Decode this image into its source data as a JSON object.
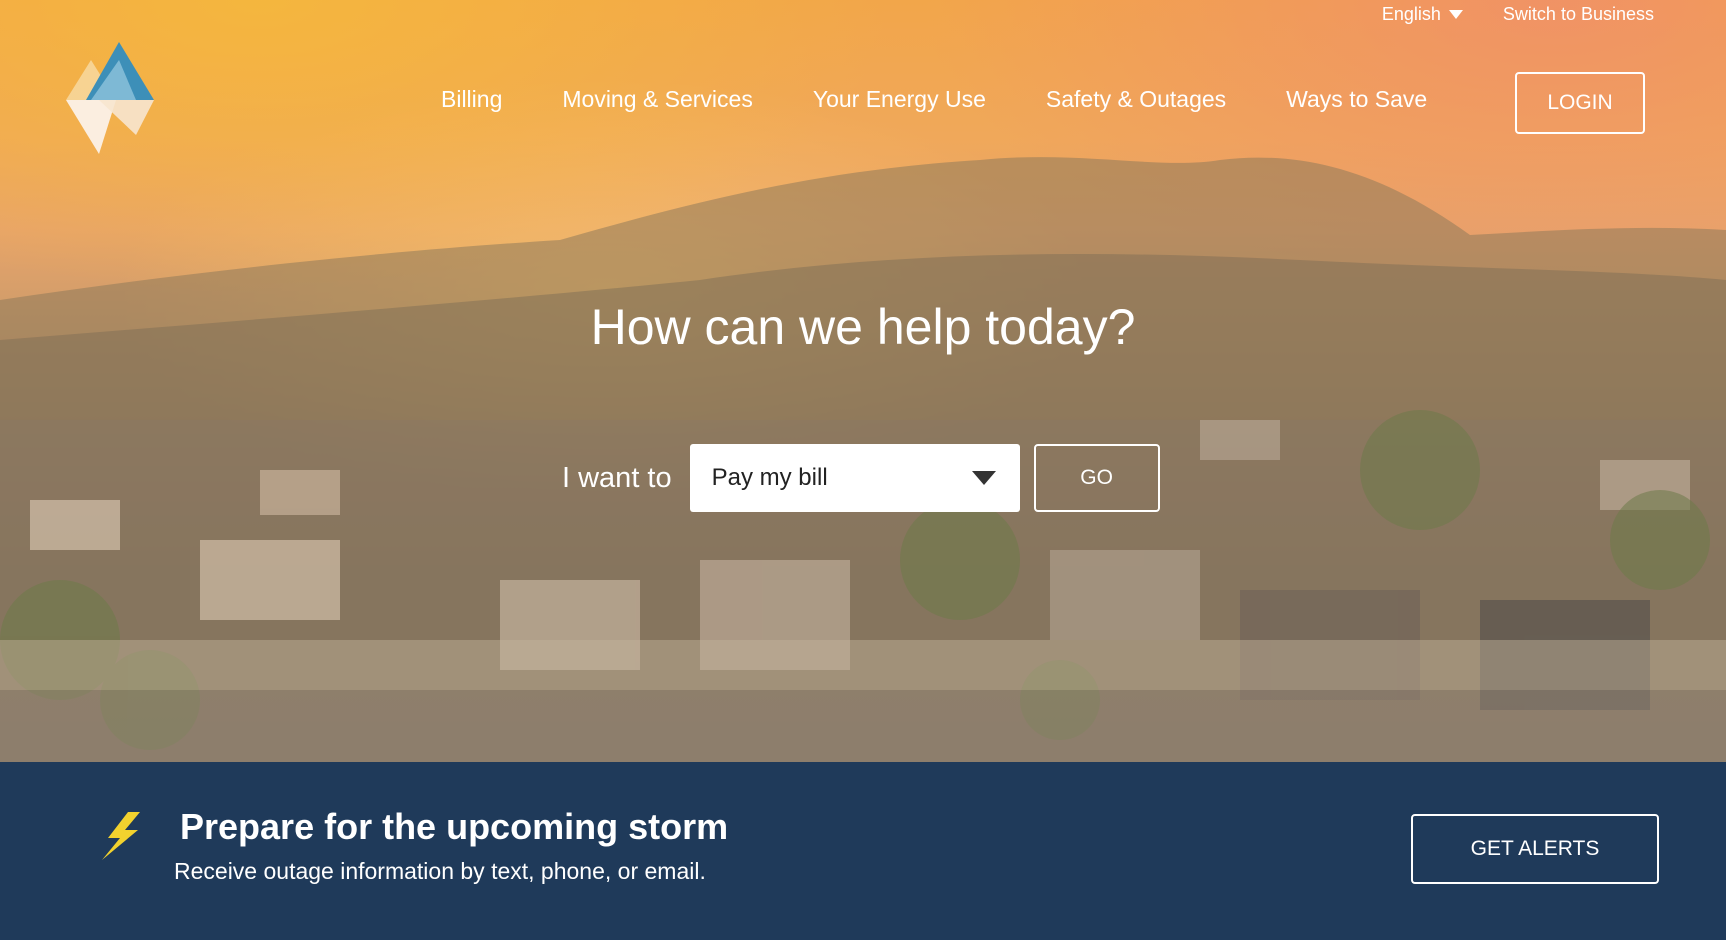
{
  "utility": {
    "language": "English",
    "switch_label": "Switch to Business"
  },
  "logo_icon": "diamond-triangles-logo",
  "nav": {
    "items": [
      {
        "label": "Billing"
      },
      {
        "label": "Moving & Services"
      },
      {
        "label": "Your Energy Use"
      },
      {
        "label": "Safety & Outages"
      },
      {
        "label": "Ways to Save"
      }
    ],
    "login_label": "LOGIN"
  },
  "hero": {
    "title": "How can we help today?",
    "want_label": "I want to",
    "selected_option": "Pay my bill",
    "go_label": "GO"
  },
  "alert": {
    "icon": "lightning-bolt-icon",
    "title": "Prepare for the upcoming storm",
    "subtitle": "Receive outage information by text, phone, or email.",
    "button_label": "GET ALERTS"
  },
  "colors": {
    "alert_bar": "#1f3a5a",
    "logo_blue": "#3d8fb8",
    "bolt_yellow": "#f2d22e"
  }
}
